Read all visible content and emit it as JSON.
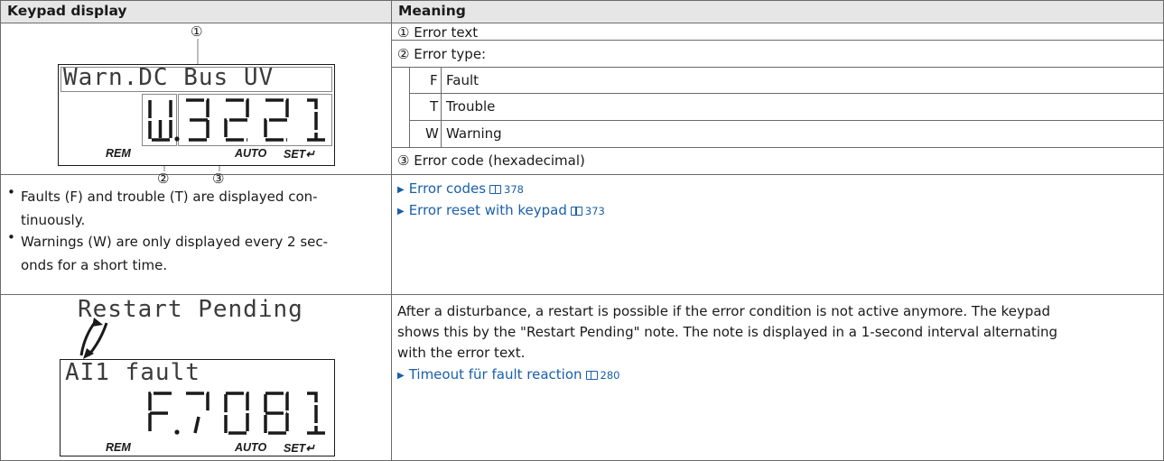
{
  "table": {
    "col_keypad": "Keypad display",
    "col_meaning": "Meaning"
  },
  "row1": {
    "lcd": {
      "text": "Warn.DC Bus UV",
      "code": "W.3221",
      "legend_rem": "REM",
      "legend_auto": "AUTO",
      "legend_set": "SET↵",
      "marker_top": "①",
      "marker_type": "②",
      "marker_code": "③"
    },
    "notes": [
      {
        "line1": "Faults (F) and trouble (T) are displayed con-",
        "line2": "tinuously."
      },
      {
        "line1": "Warnings (W) are only displayed every 2 sec-",
        "line2": "onds for a short time."
      }
    ],
    "meaning_error_text": "① Error text",
    "meaning_error_type": "② Error type:",
    "types": [
      {
        "code": "F",
        "label": "Fault"
      },
      {
        "code": "T",
        "label": "Trouble"
      },
      {
        "code": "W",
        "label": "Warning"
      }
    ],
    "meaning_error_code": "③ Error code (hexadecimal)",
    "links": [
      {
        "text": "Error codes",
        "page": "378"
      },
      {
        "text": "Error reset with keypad",
        "page": "373"
      }
    ]
  },
  "row2": {
    "restart_label": "Restart Pending",
    "lcd": {
      "text": "AI1 fault",
      "code": "F.7081",
      "legend_rem": "REM",
      "legend_auto": "AUTO",
      "legend_set": "SET↵"
    },
    "description": [
      "After a disturbance, a restart is possible if the error condition is not active anymore. The keypad",
      "shows this by the \"Restart Pending\" note. The note is displayed in a 1-second interval alternating",
      "with the error text."
    ],
    "link": {
      "text": "Timeout für fault reaction",
      "page": "280"
    }
  }
}
